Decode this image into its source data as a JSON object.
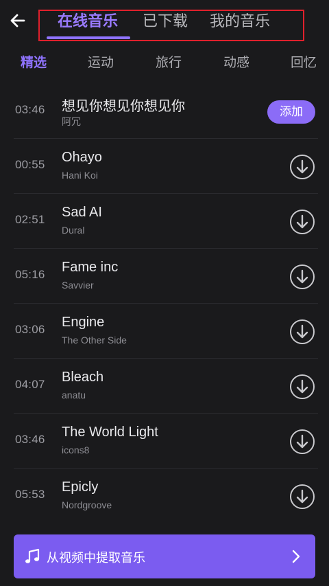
{
  "header": {
    "back_icon": "arrow-left-icon",
    "tabs": [
      {
        "label": "在线音乐",
        "active": true
      },
      {
        "label": "已下载",
        "active": false
      },
      {
        "label": "我的音乐",
        "active": false
      }
    ]
  },
  "categories": [
    {
      "label": "精选",
      "active": true
    },
    {
      "label": "运动",
      "active": false
    },
    {
      "label": "旅行",
      "active": false
    },
    {
      "label": "动感",
      "active": false
    },
    {
      "label": "回忆",
      "active": false
    }
  ],
  "songs": [
    {
      "duration": "03:46",
      "title": "想见你想见你想见你",
      "artist": "阿冗",
      "action": "add",
      "action_label": "添加"
    },
    {
      "duration": "00:55",
      "title": "Ohayo",
      "artist": "Hani Koi",
      "action": "download"
    },
    {
      "duration": "02:51",
      "title": "Sad AI",
      "artist": "Dural",
      "action": "download"
    },
    {
      "duration": "05:16",
      "title": "Fame inc",
      "artist": "Savvier",
      "action": "download"
    },
    {
      "duration": "03:06",
      "title": "Engine",
      "artist": "The Other Side",
      "action": "download"
    },
    {
      "duration": "04:07",
      "title": "Bleach",
      "artist": "anatu",
      "action": "download"
    },
    {
      "duration": "03:46",
      "title": "The World Light",
      "artist": "icons8",
      "action": "download"
    },
    {
      "duration": "05:53",
      "title": "Epicly",
      "artist": "Nordgroove",
      "action": "download"
    }
  ],
  "extract_button": {
    "label": "从视频中提取音乐",
    "icon": "music-note-icon",
    "chevron": "chevron-right-icon"
  },
  "colors": {
    "accent": "#8f73ff",
    "button": "#7b5cf0",
    "background": "#1a1a1c",
    "highlight_box": "#e0202c"
  }
}
